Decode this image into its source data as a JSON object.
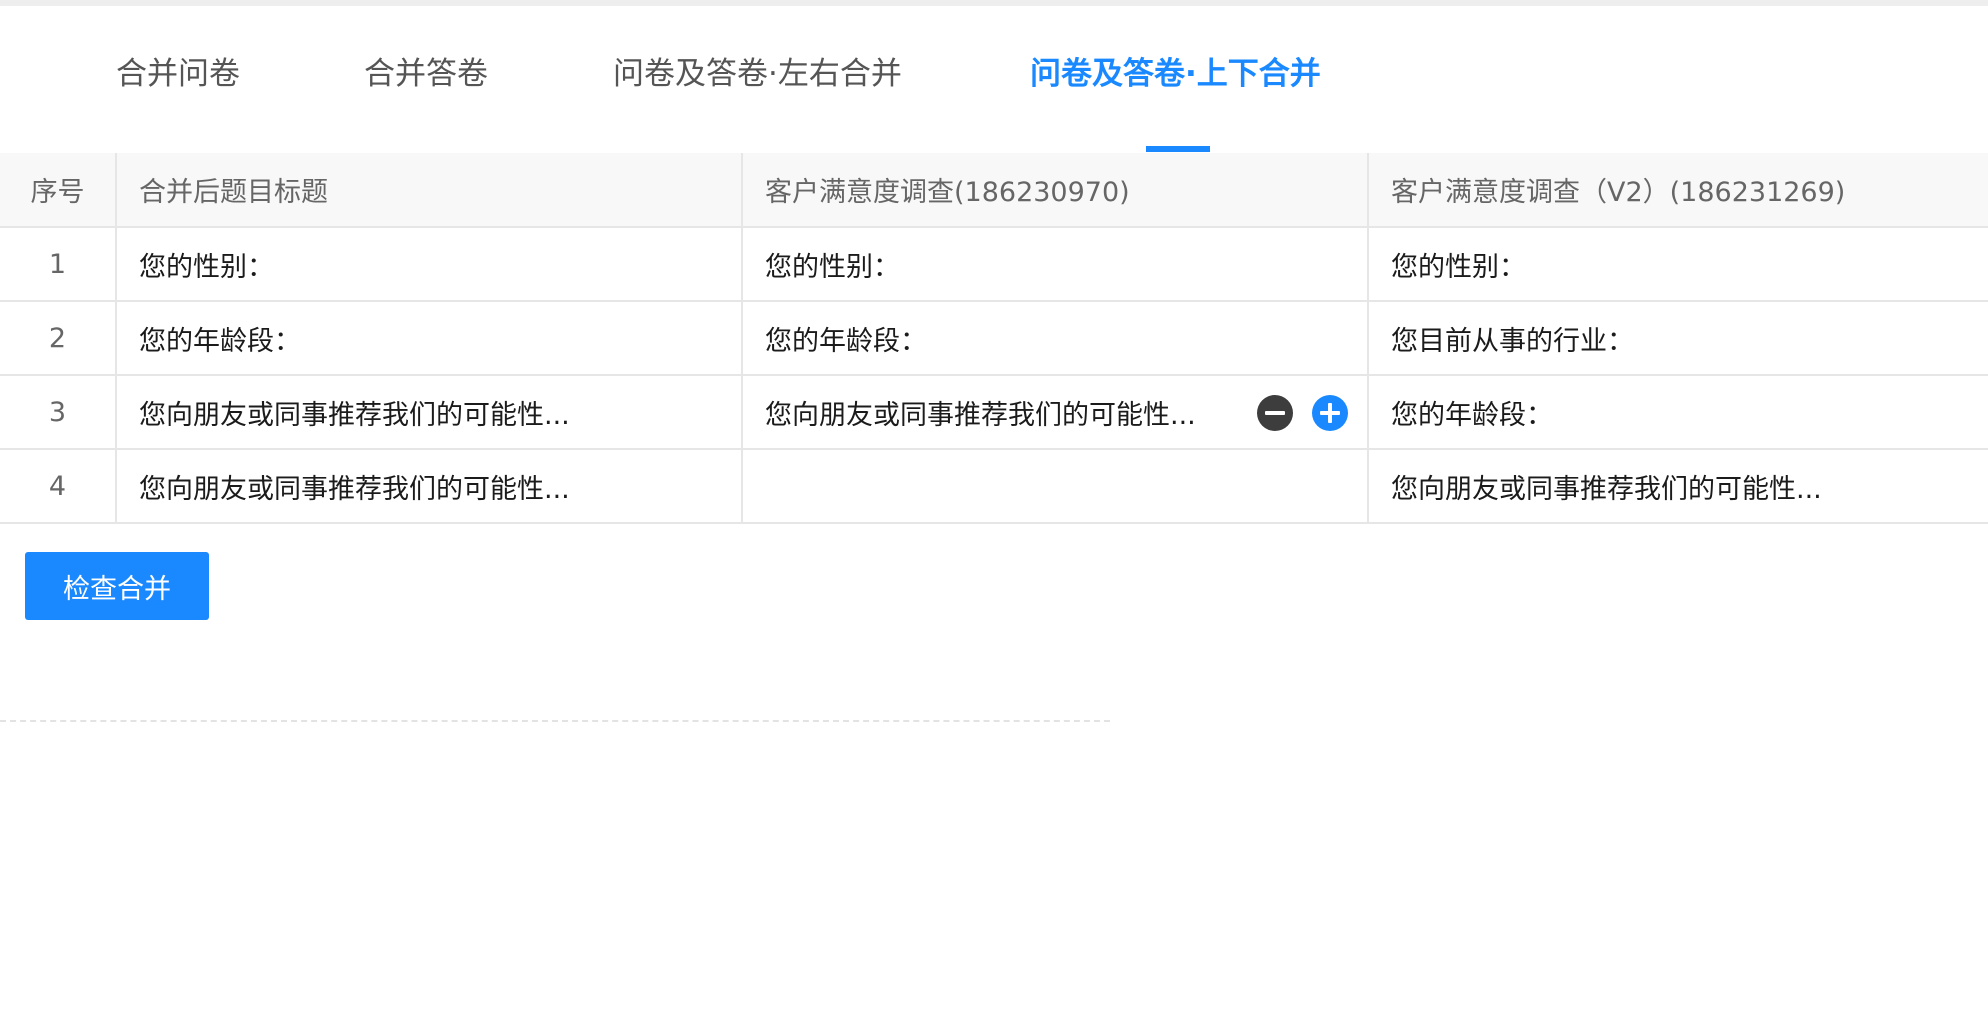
{
  "tabs": [
    {
      "label": "合并问卷"
    },
    {
      "label": "合并答卷"
    },
    {
      "label": "问卷及答卷·左右合并"
    },
    {
      "label": "问卷及答卷·上下合并"
    }
  ],
  "active_tab": "问卷及答卷·上下合并",
  "table": {
    "headers": [
      "序号",
      "合并后题目标题",
      "客户满意度调查(186230970)",
      "客户满意度调查（V2）(186231269)"
    ],
    "rows": [
      {
        "no": "1",
        "target": "您的性别：",
        "survey_a": "您的性别：",
        "survey_b": "您的性别："
      },
      {
        "no": "2",
        "target": "您的年龄段：",
        "survey_a": "您的年龄段：",
        "survey_b": "您目前从事的行业："
      },
      {
        "no": "3",
        "target": "您向朋友或同事推荐我们的可能性...",
        "survey_a": "您向朋友或同事推荐我们的可能性...",
        "survey_b": "您的年龄段："
      },
      {
        "no": "4",
        "target": "您向朋友或同事推荐我们的可能性...",
        "survey_a": "",
        "survey_b": "您向朋友或同事推荐我们的可能性..."
      }
    ]
  },
  "row_controls": {
    "remove_icon": "minus-circle-icon",
    "add_icon": "plus-circle-icon"
  },
  "check_button": {
    "label": "检查合并"
  },
  "colors": {
    "accent": "#1a89ff",
    "remove": "#3d3d3d",
    "header_bg": "#f8f8f8",
    "border": "#e6e6e6"
  }
}
